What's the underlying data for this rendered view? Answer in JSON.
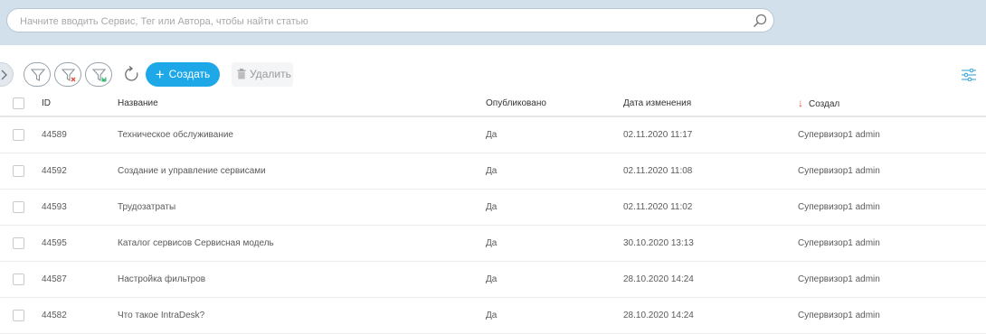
{
  "search": {
    "placeholder": "Начните вводить Сервис, Тег или Автора, чтобы найти статью"
  },
  "toolbar": {
    "create_label": "Создать",
    "delete_label": "Удалить"
  },
  "table": {
    "columns": {
      "id": "ID",
      "name": "Название",
      "published": "Опубликовано",
      "modified": "Дата изменения",
      "created_by": "Создал"
    },
    "sort_indicator": "↓",
    "rows": [
      {
        "id": "44589",
        "name": "Техническое обслуживание",
        "published": "Да",
        "modified": "02.11.2020 11:17",
        "created_by": "Супервизор1 admin"
      },
      {
        "id": "44592",
        "name": "Создание и управление сервисами",
        "published": "Да",
        "modified": "02.11.2020 11:08",
        "created_by": "Супервизор1 admin"
      },
      {
        "id": "44593",
        "name": "Трудозатраты",
        "published": "Да",
        "modified": "02.11.2020 11:02",
        "created_by": "Супервизор1 admin"
      },
      {
        "id": "44595",
        "name": "Каталог сервисов Сервисная модель",
        "published": "Да",
        "modified": "30.10.2020 13:13",
        "created_by": "Супервизор1 admin"
      },
      {
        "id": "44587",
        "name": "Настройка фильтров",
        "published": "Да",
        "modified": "28.10.2020 14:24",
        "created_by": "Супервизор1 admin"
      },
      {
        "id": "44582",
        "name": "Что такое IntraDesk?",
        "published": "Да",
        "modified": "28.10.2020 14:24",
        "created_by": "Супервизор1 admin"
      }
    ]
  },
  "colors": {
    "accent": "#1ea8e8",
    "header_band": "#d2e0ec",
    "sort_arrow": "#e24a3b"
  },
  "icons": [
    "search-icon",
    "chevron-right-icon",
    "filter-icon",
    "filter-clear-icon",
    "filter-save-icon",
    "refresh-icon",
    "plus-icon",
    "trash-icon",
    "settings-sliders-icon"
  ]
}
